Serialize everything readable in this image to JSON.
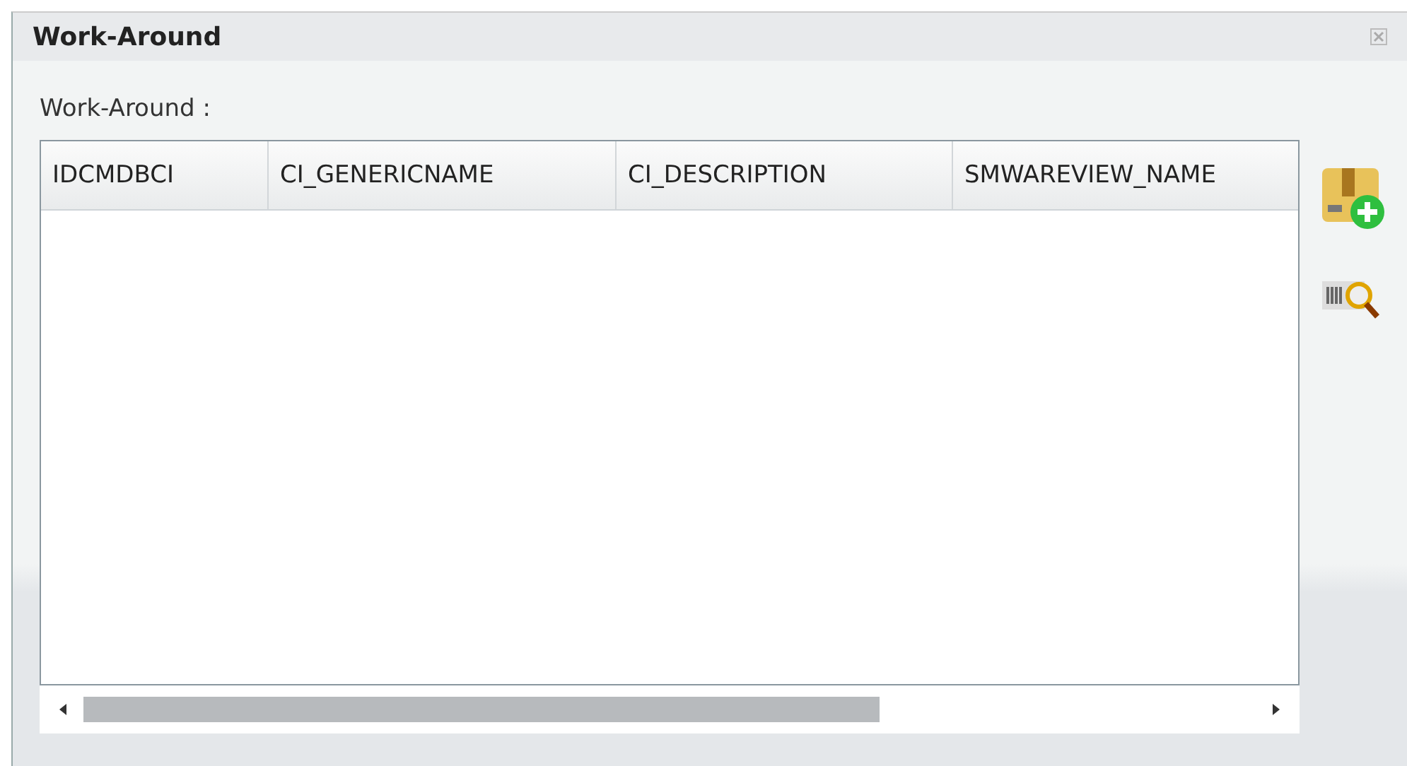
{
  "window": {
    "title": "Work-Around"
  },
  "field_label": "Work-Around :",
  "table": {
    "columns": [
      "IDCMDBCI",
      "CI_GENERICNAME",
      "CI_DESCRIPTION",
      "SMWAREVIEW_NAME"
    ]
  }
}
